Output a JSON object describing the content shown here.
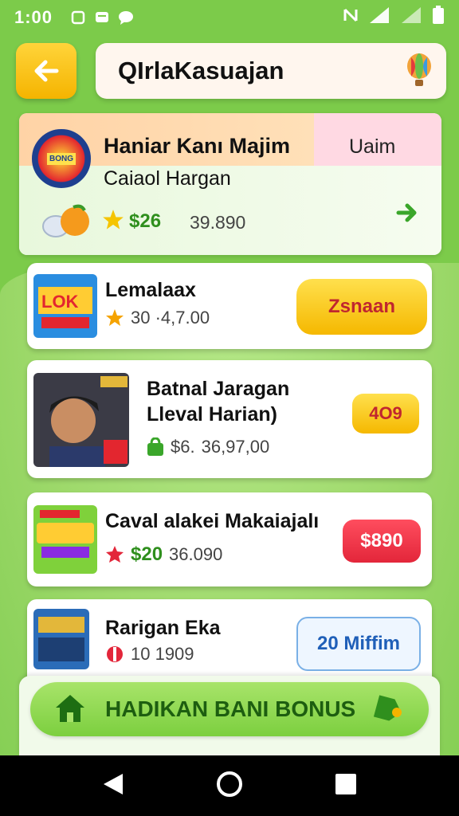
{
  "status_bar": {
    "time": "1:00"
  },
  "header": {
    "title": "QIrlaKasuajan"
  },
  "featured": {
    "title": "Haniar Kanı Majim",
    "tag": "Uaim",
    "subtitle": "Caiaol Hargan",
    "price": "$26",
    "value": "39.890"
  },
  "items": [
    {
      "name": "Lemalaax",
      "price": "",
      "value": "30 ·4,7.00",
      "button": "Zsnaan"
    },
    {
      "name": "Batnal Jaragan\nLleval Harian)",
      "price": "$6.",
      "value": "36,97,00",
      "button": "4O9"
    },
    {
      "name": "Caval alakei Makaiajalı",
      "price": "$20",
      "value": "36.090",
      "button": "$890"
    },
    {
      "name": "Rarigan Eka",
      "price": "",
      "value": "10 1909",
      "button": "20 Miffim"
    }
  ],
  "bonus": {
    "label": "HADIKAN BANI BONUS"
  },
  "colors": {
    "accent": "#7ccb4a",
    "yellow": "#f5b400",
    "red": "#e3263a",
    "green_text": "#2f8f1d"
  }
}
